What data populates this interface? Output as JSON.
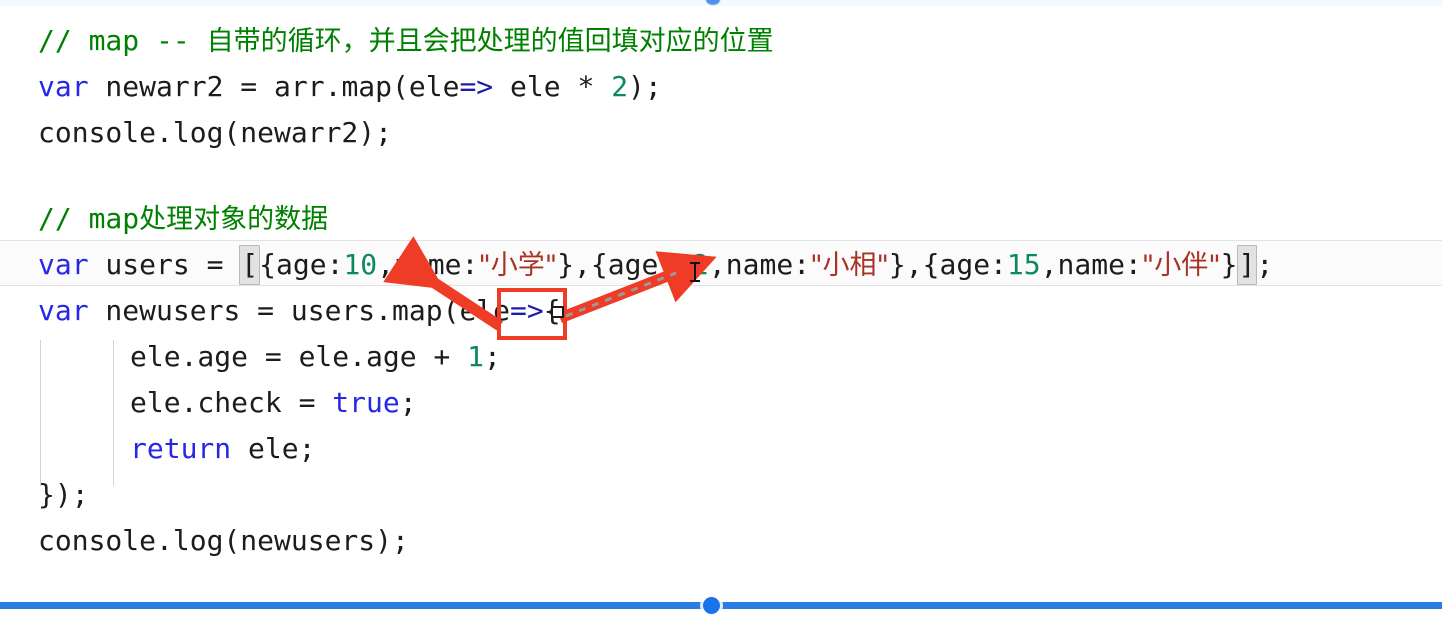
{
  "window": {
    "app": "code-editor",
    "background": "#ffffff"
  },
  "theme": {
    "comment_color": "#008000",
    "keyword_color": "#2727e6",
    "number_color": "#0b8a60",
    "string_color": "#a93226",
    "plain_color": "#1c1c1c",
    "arrow_color": "#1d1da8",
    "current_line_bg": "#fbfbfb",
    "current_line_border": "#e2e2e2",
    "indent_guide_color": "#d3d3d3",
    "bracket_match_bg": "#e2e2e2",
    "annotation_color": "#ef3c26",
    "scrubber_played_color": "#2a7de1",
    "scrubber_track_color": "#6b6b6b",
    "scrubber_handle_color": "#1a73e8"
  },
  "code": {
    "line1": {
      "comment_slashes": "// ",
      "comment_ascii": "map -- ",
      "comment_cjk": "自带的循环，并且会把处理的值回填对应的位置"
    },
    "line2": {
      "keyword": "var",
      "before_arrow": " newarr2 = arr.map(ele",
      "arrow": "=>",
      "mid": " ele * ",
      "number": "2",
      "tail": ");"
    },
    "line3": {
      "text": "console.log(newarr2);"
    },
    "line5": {
      "comment_slashes": "// ",
      "comment_ascii": "map",
      "comment_cjk": "处理对象的数据"
    },
    "line6": {
      "keyword": "var",
      "ident": " users = ",
      "open_bracket": "[",
      "obj1_pre": "{age:",
      "obj1_age": "10",
      "obj1_mid": ",name:",
      "obj1_name": "\"小学\"",
      "obj1_post": "},",
      "obj2_pre": "{age:",
      "obj2_age": "12",
      "obj2_mid": ",name:",
      "obj2_name": "\"小相\"",
      "obj2_post": "},",
      "obj3_pre": "{age:",
      "obj3_age": "15",
      "obj3_mid": ",name:",
      "obj3_name": "\"小伴\"",
      "obj3_post": "}",
      "close_bracket": "]",
      "semicolon": ";"
    },
    "line7": {
      "keyword": "var",
      "before_arrow": " newusers = users.map(ele",
      "arrow": "=>",
      "tail": "{"
    },
    "line8": {
      "pre": "ele.age = ele.age + ",
      "number": "1",
      "post": ";"
    },
    "line9": {
      "pre": "ele.check = ",
      "bool": "true",
      "post": ";"
    },
    "line10": {
      "keyword": "return",
      "rest": " ele;"
    },
    "line11": {
      "text": "});"
    },
    "line12": {
      "text": "console.log(newusers);"
    }
  },
  "annotations": {
    "highlight_box_label": "ele-parameter-highlight",
    "arrow_left_label": "arrow-to-first-object",
    "arrow_right_label": "arrow-to-second-object"
  },
  "player": {
    "progress_percent": 49.3,
    "buffered_percent": 100
  }
}
